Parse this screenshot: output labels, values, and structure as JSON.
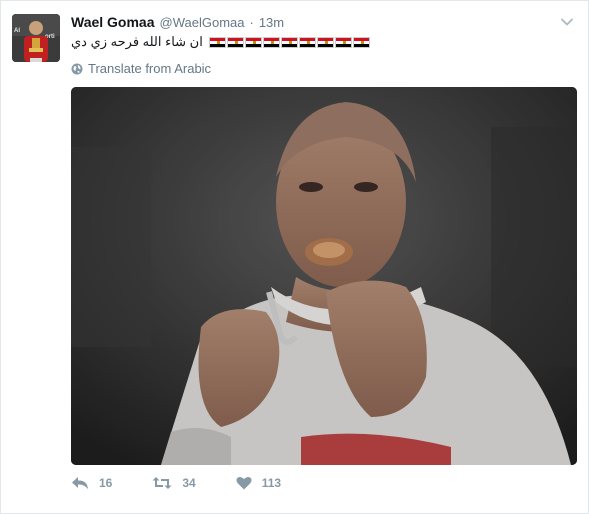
{
  "tweet": {
    "fullname": "Wael Gomaa",
    "username": "@WaelGomaa",
    "dot": "·",
    "time": "13m",
    "text": "ان شاء الله فرحه زي دي",
    "flag_count": 9,
    "translate_label": "Translate from Arabic",
    "avatar_text": "Al Sport"
  },
  "actions": {
    "reply_count": "16",
    "retweet_count": "34",
    "like_count": "113"
  },
  "colors": {
    "accent": "#1da1f2",
    "muted": "#657786",
    "action_gray": "#8899a6",
    "flag_red": "#ce1126",
    "flag_gold": "#c09300"
  },
  "icons": {
    "reply": "reply-icon",
    "retweet": "retweet-icon",
    "like": "heart-icon",
    "globe": "globe-icon",
    "caret": "chevron-down-icon"
  }
}
